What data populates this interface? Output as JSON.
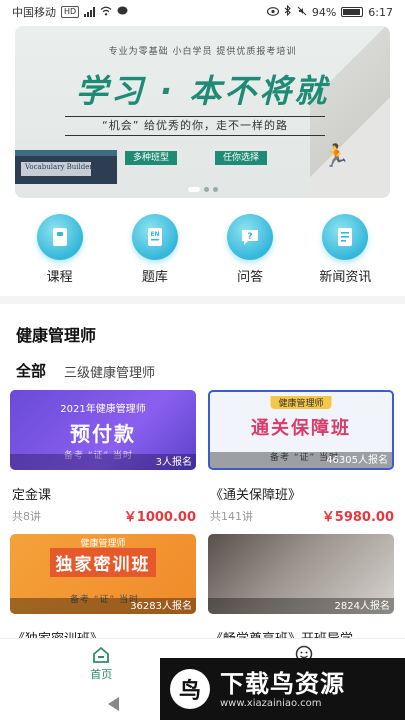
{
  "status_bar": {
    "carrier": "中国移动",
    "network_badge": "HD",
    "battery_percent": "94%",
    "time": "6:17"
  },
  "banner": {
    "tagline": "专业为零基础  小白学员  提供优质报考培训",
    "headline": "学习 · 本不将就",
    "slogan": "“机会” 给优秀的你，走不一样的路",
    "tag1": "多种班型",
    "tag2": "任你选择",
    "book_text": "Vocabulary Builder"
  },
  "categories": [
    {
      "label": "课程",
      "icon": "book-icon"
    },
    {
      "label": "题库",
      "icon": "question-bank-icon"
    },
    {
      "label": "问答",
      "icon": "qa-bubble-icon"
    },
    {
      "label": "新闻资讯",
      "icon": "news-icon"
    }
  ],
  "section": {
    "title": "健康管理师",
    "tabs": [
      "全部",
      "三级健康管理师"
    ]
  },
  "courses": [
    {
      "title": "定金课",
      "lessons": "共8讲",
      "price": "￥1000.00",
      "enrolled": "3人报名",
      "thumb_line1": "2021年健康管理师",
      "thumb_big": "预付款",
      "thumb_sub": "备考 “证” 当时"
    },
    {
      "title": "《通关保障班》",
      "lessons": "共141讲",
      "price": "￥5980.00",
      "enrolled": "46305人报名",
      "thumb_pill": "健康管理师",
      "thumb_big": "通关保障班",
      "thumb_sub": "备考 “证” 当时"
    },
    {
      "title": "《独家密训班》",
      "lessons": "",
      "price": "",
      "enrolled": "36283人报名",
      "thumb_pill": "健康管理师",
      "thumb_big": "独家密训班",
      "thumb_sub": "备考 “证” 当时"
    },
    {
      "title": "《畅学尊享班》开班导学",
      "lessons": "",
      "price": "",
      "enrolled": "2824人报名"
    }
  ],
  "bottom_nav": {
    "home_label": "首页"
  },
  "watermark": {
    "logo_char": "鸟",
    "cn": "下载鸟资源",
    "url": "www.xiazainiao.com"
  },
  "colors": {
    "accent": "#2b8f6a",
    "price": "#e8373f",
    "icon_bg": "#35b7da"
  }
}
